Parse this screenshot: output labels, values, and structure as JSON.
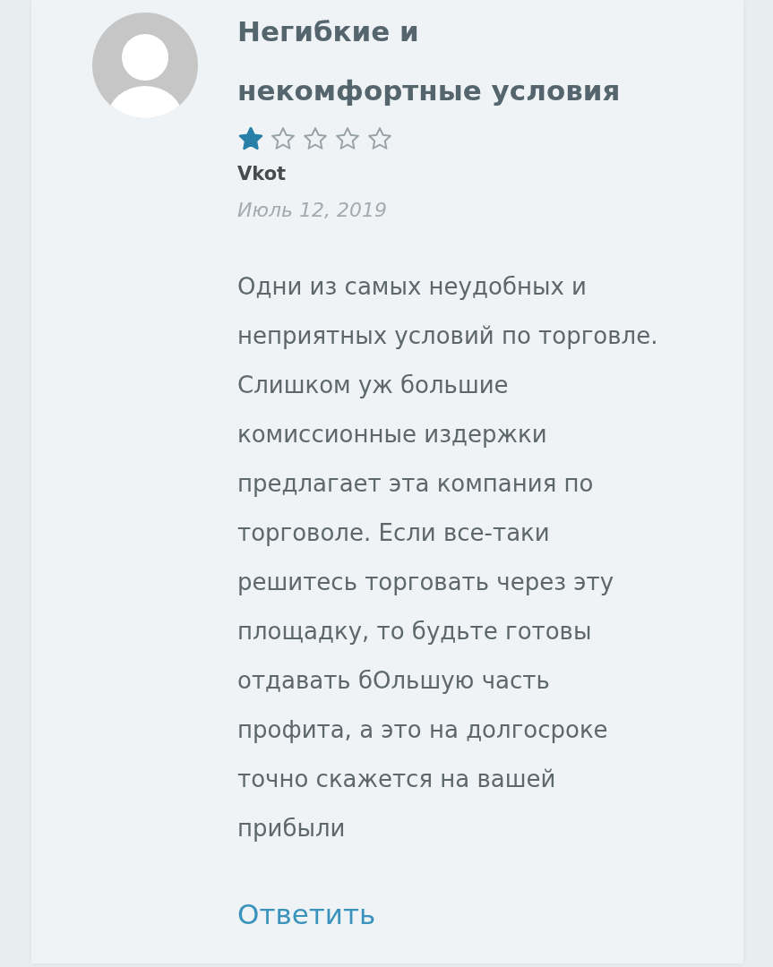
{
  "review": {
    "title": "Негибкие и некомфортные условия",
    "stars": 1,
    "author": "Vkot",
    "date": "Июль 12, 2019",
    "text": "Одни из самых неудобных и неприятных условий по торговле. Слишком уж большие комиссионные издержки предлагает эта компания по торговоле. Если все-таки решитесь торговать через эту площадку, то будьте готовы отдавать бОльшую часть профита, а это на долгосроке точно скажется на вашей прибыли",
    "reply_link": "Ответить"
  }
}
